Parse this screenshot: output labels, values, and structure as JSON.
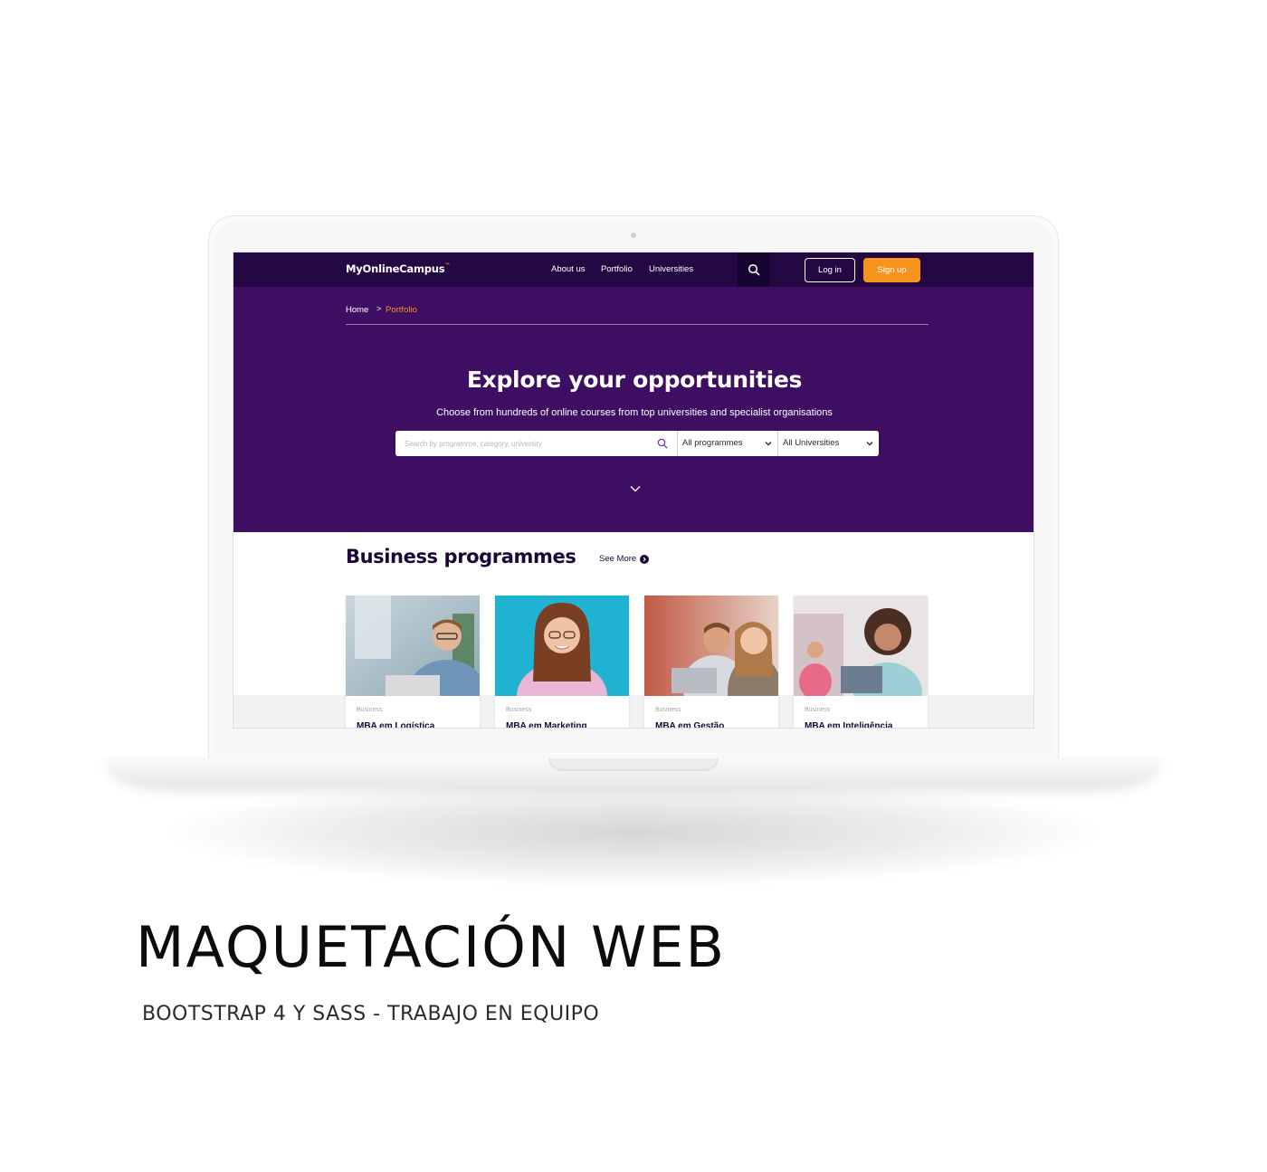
{
  "site": {
    "logo_text": "MyOnlineCampus",
    "logo_tm": "™",
    "nav": {
      "about": "About us",
      "portfolio": "Portfolio",
      "universities": "Universities",
      "login": "Log in",
      "signup": "Sign up"
    },
    "breadcrumb": {
      "home": "Home",
      "separator": ">",
      "current": "Portfolio"
    },
    "hero": {
      "title": "Explore your opportunities",
      "subtitle": "Choose from hundreds of online courses from top universities and specialist organisations",
      "search_placeholder": "Search by programme, category, university",
      "programmes_selected": "All programmes",
      "universities_selected": "All Universities"
    },
    "section": {
      "title": "Business programmes",
      "see_more": "See More"
    },
    "cards": [
      {
        "category": "Business",
        "title": "MBA em Logística"
      },
      {
        "category": "Business",
        "title": "MBA em Marketing"
      },
      {
        "category": "Business",
        "title": "MBA em Gestão"
      },
      {
        "category": "Business",
        "title": "MBA em Inteligência"
      }
    ],
    "colors": {
      "nav_bg": "#230844",
      "hero_bg": "#3d0e62",
      "accent_orange": "#f7941d",
      "heading_dark": "#1c0637"
    }
  },
  "caption": {
    "title": "MAQUETACIÓN WEB",
    "subtitle": "BOOTSTRAP 4 Y SASS - TRABAJO EN EQUIPO"
  }
}
